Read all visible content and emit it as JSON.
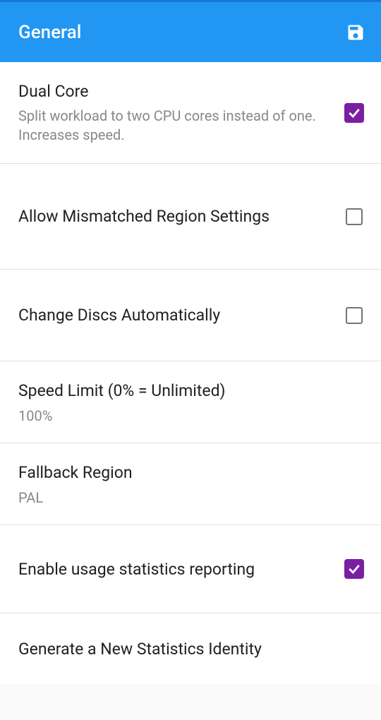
{
  "header": {
    "title": "General"
  },
  "settings": {
    "dualCore": {
      "title": "Dual Core",
      "description": "Split workload to two CPU cores instead of one. Increases speed.",
      "checked": true
    },
    "mismatchedRegion": {
      "title": "Allow Mismatched Region Settings",
      "checked": false
    },
    "changeDiscs": {
      "title": "Change Discs Automatically",
      "checked": false
    },
    "speedLimit": {
      "title": "Speed Limit (0% = Unlimited)",
      "value": "100%"
    },
    "fallbackRegion": {
      "title": "Fallback Region",
      "value": "PAL"
    },
    "usageStats": {
      "title": "Enable usage statistics reporting",
      "checked": true
    },
    "newStatsIdentity": {
      "title": "Generate a New Statistics Identity"
    }
  }
}
